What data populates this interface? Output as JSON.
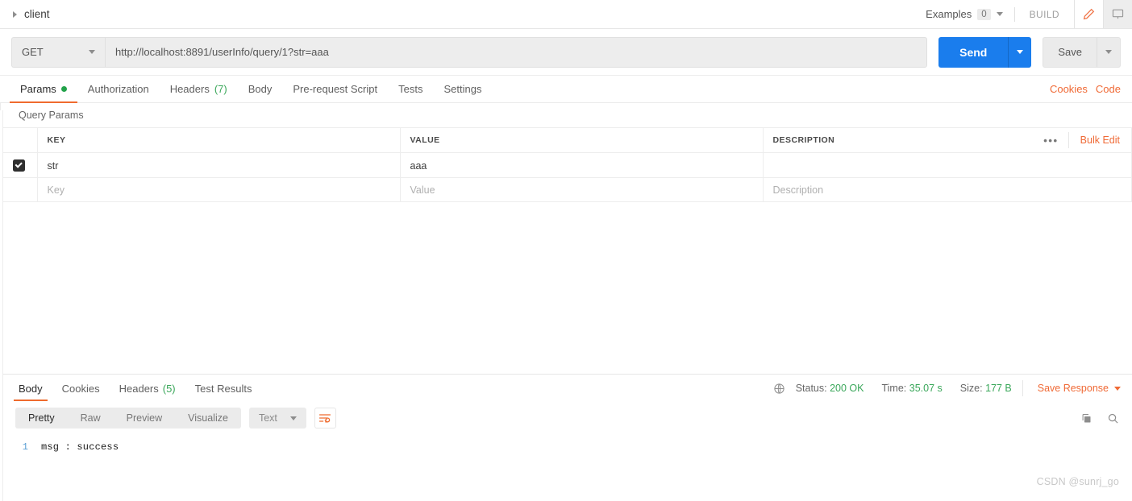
{
  "topbar": {
    "tab_title": "client",
    "examples_label": "Examples",
    "examples_count": "0",
    "build_label": "BUILD",
    "edit_icon": "pencil-icon",
    "comment_icon": "comment-icon"
  },
  "request": {
    "method": "GET",
    "url": "http://localhost:8891/userInfo/query/1?str=aaa",
    "send_label": "Send",
    "save_label": "Save",
    "tabs": [
      {
        "label": "Params",
        "dot": true,
        "active": true
      },
      {
        "label": "Authorization",
        "active": false
      },
      {
        "label": "Headers",
        "count": "(7)",
        "active": false
      },
      {
        "label": "Body",
        "active": false
      },
      {
        "label": "Pre-request Script",
        "active": false
      },
      {
        "label": "Tests",
        "active": false
      },
      {
        "label": "Settings",
        "active": false
      }
    ],
    "cookies_link": "Cookies",
    "code_link": "Code"
  },
  "query_params": {
    "section_title": "Query Params",
    "columns": [
      "KEY",
      "VALUE",
      "DESCRIPTION"
    ],
    "more_icon": "•••",
    "bulk_edit_label": "Bulk Edit",
    "rows": [
      {
        "checked": true,
        "key": "str",
        "value": "aaa",
        "description": ""
      }
    ],
    "placeholder_row": {
      "key": "Key",
      "value": "Value",
      "description": "Description"
    }
  },
  "response": {
    "tabs": [
      {
        "label": "Body",
        "active": true
      },
      {
        "label": "Cookies",
        "active": false
      },
      {
        "label": "Headers",
        "count": "(5)",
        "active": false
      },
      {
        "label": "Test Results",
        "active": false
      }
    ],
    "globe_icon": "globe-icon",
    "status_label": "Status:",
    "status_value": "200 OK",
    "time_label": "Time:",
    "time_value": "35.07 s",
    "size_label": "Size:",
    "size_value": "177 B",
    "save_response_label": "Save Response",
    "view_modes": [
      {
        "label": "Pretty",
        "active": true
      },
      {
        "label": "Raw",
        "active": false
      },
      {
        "label": "Preview",
        "active": false
      },
      {
        "label": "Visualize",
        "active": false
      }
    ],
    "format_type": "Text",
    "wrap_icon": "wrap-text-icon",
    "copy_icon": "copy-icon",
    "search_icon": "search-icon",
    "body_lines": [
      {
        "no": "1",
        "text": "msg : success"
      }
    ]
  },
  "watermark": "CSDN @sunrj_go",
  "colors": {
    "accent_orange": "#f06a36",
    "send_blue": "#1a7ded",
    "status_green": "#3aa75a"
  }
}
